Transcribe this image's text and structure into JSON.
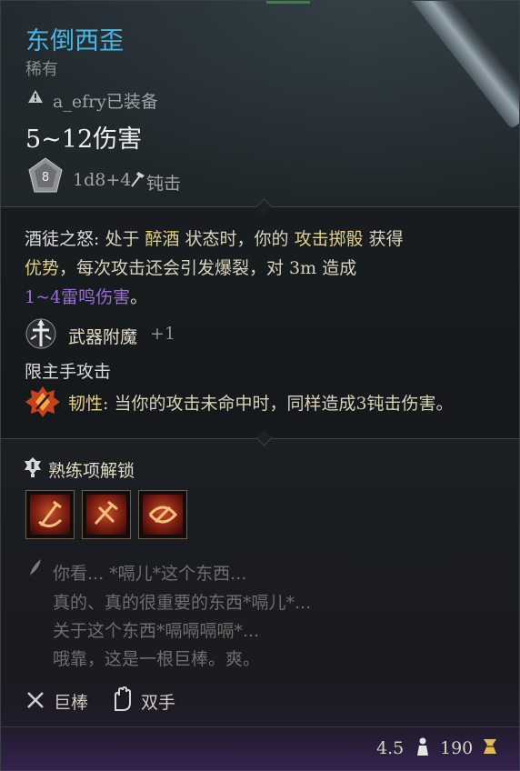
{
  "item": {
    "name": "东倒西歪",
    "rarity": "稀有",
    "equipped_by": "a_efry已装备",
    "damage": "5~12伤害",
    "damage_dice": "1d8+4",
    "damage_type": "钝击",
    "die_face": "8"
  },
  "passive": {
    "line1": {
      "name": "酒徒之怒:",
      "a": " 处于 ",
      "kw1": "醉酒",
      "b": " 状态时，你的 ",
      "kw2": "攻击掷骰",
      "c": " 获得"
    },
    "line2": {
      "a": "优势",
      "b": "，每次攻击还会引发爆裂，对 3m 造成"
    },
    "line3": {
      "a": "1~4雷鸣伤害",
      "b": "。"
    }
  },
  "enchantment": {
    "label": "武器附魔",
    "value": "+1"
  },
  "mainhand": "限主手攻击",
  "toughness": {
    "name": "韧性:",
    "text": " 当你的攻击未命中时，同样造成3钝击伤害。"
  },
  "proficiency": {
    "label": "熟练项解锁",
    "slots": [
      "slot-1",
      "slot-2",
      "slot-3"
    ]
  },
  "lore": [
    "你看... *嗝儿*这个东西...",
    "真的、真的很重要的东西*嗝儿*...",
    "关于这个东西*嗝嗝嗝嗝*...",
    "哦靠，这是一根巨棒。爽。"
  ],
  "tags": {
    "type": "巨棒",
    "hands": "双手"
  },
  "footer": {
    "weight": "4.5",
    "value": "190"
  },
  "colors": {
    "name": "#48b7e3",
    "keyword": "#e3cf86",
    "thunder": "#9a6cd8"
  }
}
